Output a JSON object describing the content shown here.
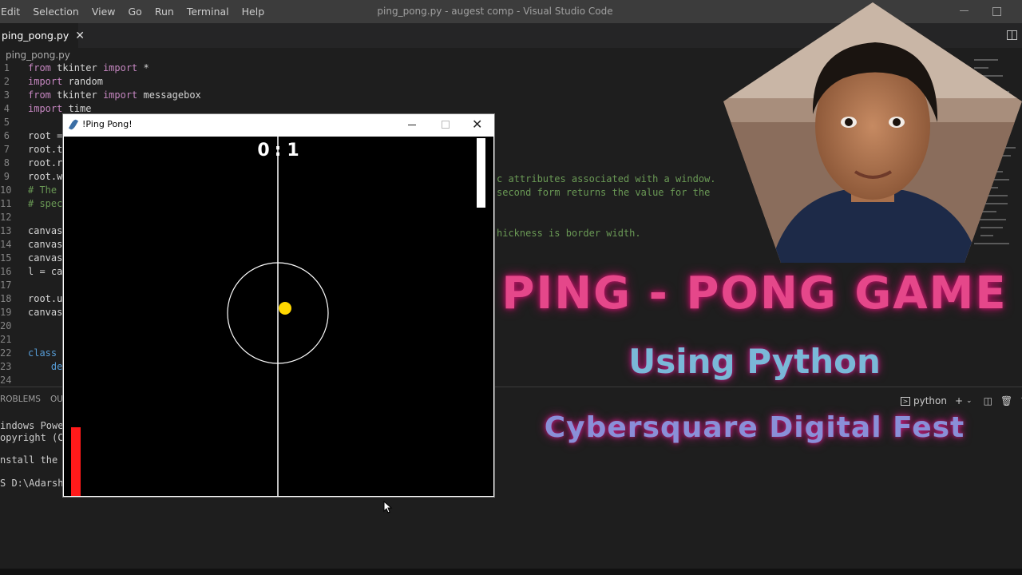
{
  "window": {
    "title": "ping_pong.py - augest comp - Visual Studio Code",
    "menu": [
      "Edit",
      "Selection",
      "View",
      "Go",
      "Run",
      "Terminal",
      "Help"
    ]
  },
  "tab": {
    "label": "ping_pong.py",
    "close_glyph": "✕"
  },
  "breadcrumb": "ping_pong.py",
  "code_lines": [
    {
      "n": "1",
      "text": "from tkinter import *"
    },
    {
      "n": "2",
      "text": "import random"
    },
    {
      "n": "3",
      "text": "from tkinter import messagebox"
    },
    {
      "n": "4",
      "text": "import time"
    },
    {
      "n": "5",
      "text": ""
    },
    {
      "n": "6",
      "text": "root ="
    },
    {
      "n": "7",
      "text": "root.t"
    },
    {
      "n": "8",
      "text": "root.r"
    },
    {
      "n": "9",
      "text": "root.w"
    },
    {
      "n": "10",
      "text": "# The"
    },
    {
      "n": "11",
      "text": "# spec"
    },
    {
      "n": "12",
      "text": ""
    },
    {
      "n": "13",
      "text": "canvas"
    },
    {
      "n": "14",
      "text": "canvas"
    },
    {
      "n": "15",
      "text": "canvas"
    },
    {
      "n": "16",
      "text": "l = ca"
    },
    {
      "n": "17",
      "text": ""
    },
    {
      "n": "18",
      "text": "root.u"
    },
    {
      "n": "19",
      "text": "canvas"
    },
    {
      "n": "20",
      "text": ""
    },
    {
      "n": "21",
      "text": ""
    },
    {
      "n": "22",
      "text": "class"
    },
    {
      "n": "23",
      "text": "    de"
    },
    {
      "n": "24",
      "text": ""
    }
  ],
  "comment_fragments": [
    "c attributes associated with a window.",
    "second form returns the value for the",
    "hickness is border width."
  ],
  "panel": {
    "tabs": [
      "ROBLEMS",
      "OU"
    ],
    "terminal_lines": [
      "indows Powers",
      "opyright (C)",
      "",
      "nstall the la",
      "",
      "S D:\\Adarsh\\"
    ],
    "shell_label": "python",
    "tool_icons": [
      "plus-icon",
      "chevron-down-icon",
      "split-terminal-icon",
      "trash-icon",
      "chevron-up-icon"
    ]
  },
  "game_window": {
    "title": "!Ping Pong!",
    "score": "0 : 1",
    "score_left": "0",
    "score_right": "1",
    "ball_color": "#ffd700",
    "left_paddle_color": "#ff1a1a",
    "right_paddle_color": "#ffffff"
  },
  "promo": {
    "title": "PING - PONG GAME",
    "subtitle": "Using Python",
    "footer": "Cybersquare Digital Fest"
  },
  "colors": {
    "editor_bg": "#1e1e1e",
    "titlebar_bg": "#3c3c3c",
    "keyword": "#c586c0",
    "comment": "#6a9955",
    "promo_pink": "#e5478a"
  }
}
